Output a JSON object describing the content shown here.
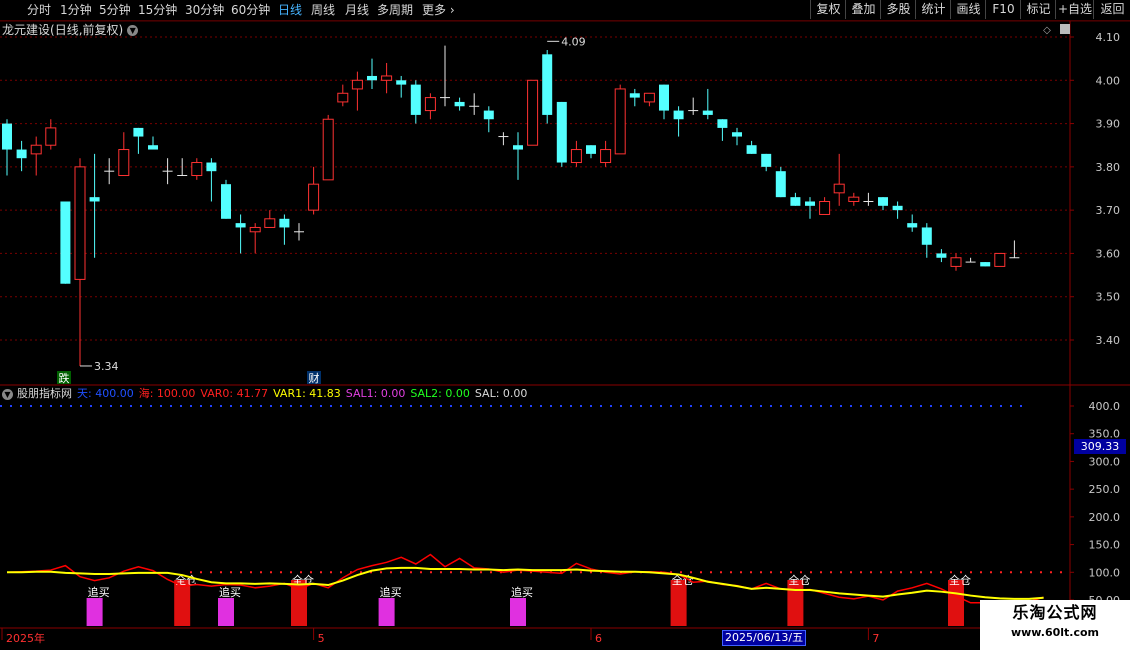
{
  "toolbar": {
    "timeframes": [
      "分时",
      "1分钟",
      "5分钟",
      "15分钟",
      "30分钟",
      "60分钟",
      "日线",
      "周线",
      "月线",
      "多周期",
      "更多"
    ],
    "active": "日线",
    "right_buttons": [
      "复权",
      "叠加",
      "多股",
      "统计",
      "画线",
      "F10",
      "标记",
      "+自选",
      "返回"
    ]
  },
  "stock": {
    "name": "龙元建设",
    "mode": "(日线,前复权)"
  },
  "price_axis": {
    "ticks": [
      "4.10",
      "4.00",
      "3.90",
      "3.80",
      "3.70",
      "3.60",
      "3.50",
      "3.40"
    ],
    "min": 3.34,
    "max": 4.09,
    "ylim": [
      3.34,
      4.12
    ]
  },
  "annotations": {
    "high_label": "4.09",
    "low_label": "3.34",
    "die_tag": "跌",
    "cai_tag": "财"
  },
  "colors": {
    "up": "#ff3232",
    "down": "#54ffff",
    "ma_yellow": "#ffff00",
    "ind_red": "#ff0000",
    "grid": "#7a0000"
  },
  "candles": [
    [
      3.9,
      3.84,
      3.91,
      3.78
    ],
    [
      3.84,
      3.82,
      3.86,
      3.79
    ],
    [
      3.83,
      3.85,
      3.87,
      3.78
    ],
    [
      3.85,
      3.89,
      3.91,
      3.84
    ],
    [
      3.72,
      3.53,
      3.72,
      3.53
    ],
    [
      3.54,
      3.8,
      3.82,
      3.34
    ],
    [
      3.73,
      3.72,
      3.83,
      3.59
    ],
    [
      3.79,
      3.79,
      3.82,
      3.76
    ],
    [
      3.78,
      3.84,
      3.88,
      3.78
    ],
    [
      3.89,
      3.87,
      3.89,
      3.83
    ],
    [
      3.85,
      3.84,
      3.87,
      3.84
    ],
    [
      3.79,
      3.79,
      3.82,
      3.76
    ],
    [
      3.78,
      3.78,
      3.82,
      3.78
    ],
    [
      3.78,
      3.81,
      3.82,
      3.77
    ],
    [
      3.81,
      3.79,
      3.82,
      3.72
    ],
    [
      3.76,
      3.68,
      3.77,
      3.68
    ],
    [
      3.67,
      3.66,
      3.69,
      3.6
    ],
    [
      3.65,
      3.66,
      3.67,
      3.6
    ],
    [
      3.66,
      3.68,
      3.7,
      3.66
    ],
    [
      3.68,
      3.66,
      3.69,
      3.62
    ],
    [
      3.65,
      3.65,
      3.67,
      3.63
    ],
    [
      3.7,
      3.76,
      3.8,
      3.69
    ],
    [
      3.77,
      3.91,
      3.92,
      3.77
    ],
    [
      3.95,
      3.97,
      3.99,
      3.94
    ],
    [
      3.98,
      4.0,
      4.02,
      3.93
    ],
    [
      4.01,
      4.0,
      4.05,
      3.98
    ],
    [
      4.0,
      4.01,
      4.04,
      3.97
    ],
    [
      4.0,
      3.99,
      4.01,
      3.96
    ],
    [
      3.99,
      3.92,
      4.0,
      3.9
    ],
    [
      3.93,
      3.96,
      3.97,
      3.91
    ],
    [
      3.96,
      3.96,
      4.08,
      3.94
    ],
    [
      3.95,
      3.94,
      3.96,
      3.93
    ],
    [
      3.94,
      3.94,
      3.97,
      3.92
    ],
    [
      3.93,
      3.91,
      3.94,
      3.88
    ],
    [
      3.87,
      3.87,
      3.88,
      3.85
    ],
    [
      3.85,
      3.84,
      3.88,
      3.77
    ],
    [
      3.85,
      4.0,
      4.0,
      3.85
    ],
    [
      4.06,
      3.92,
      4.07,
      3.9
    ],
    [
      3.95,
      3.81,
      3.95,
      3.8
    ],
    [
      3.81,
      3.84,
      3.86,
      3.8
    ],
    [
      3.85,
      3.83,
      3.85,
      3.82
    ],
    [
      3.81,
      3.84,
      3.86,
      3.8
    ],
    [
      3.83,
      3.98,
      3.99,
      3.83
    ],
    [
      3.97,
      3.96,
      3.98,
      3.94
    ],
    [
      3.95,
      3.97,
      3.97,
      3.94
    ],
    [
      3.99,
      3.93,
      3.99,
      3.91
    ],
    [
      3.93,
      3.91,
      3.94,
      3.87
    ],
    [
      3.93,
      3.93,
      3.96,
      3.92
    ],
    [
      3.93,
      3.92,
      3.98,
      3.91
    ],
    [
      3.91,
      3.89,
      3.91,
      3.86
    ],
    [
      3.88,
      3.87,
      3.89,
      3.85
    ],
    [
      3.85,
      3.83,
      3.86,
      3.83
    ],
    [
      3.83,
      3.8,
      3.83,
      3.79
    ],
    [
      3.79,
      3.73,
      3.8,
      3.73
    ],
    [
      3.73,
      3.71,
      3.74,
      3.71
    ],
    [
      3.72,
      3.71,
      3.73,
      3.68
    ],
    [
      3.69,
      3.72,
      3.73,
      3.69
    ],
    [
      3.74,
      3.76,
      3.83,
      3.71
    ],
    [
      3.72,
      3.73,
      3.74,
      3.71
    ],
    [
      3.72,
      3.72,
      3.74,
      3.71
    ],
    [
      3.73,
      3.71,
      3.73,
      3.7
    ],
    [
      3.71,
      3.7,
      3.72,
      3.68
    ],
    [
      3.67,
      3.66,
      3.69,
      3.65
    ],
    [
      3.66,
      3.62,
      3.67,
      3.59
    ],
    [
      3.6,
      3.59,
      3.61,
      3.58
    ],
    [
      3.57,
      3.59,
      3.6,
      3.56
    ],
    [
      3.58,
      3.58,
      3.59,
      3.58
    ],
    [
      3.58,
      3.57,
      3.58,
      3.57
    ],
    [
      3.57,
      3.6,
      3.6,
      3.57
    ],
    [
      3.59,
      3.59,
      3.63,
      3.59
    ]
  ],
  "indicator": {
    "name": "股朋指标网",
    "params": [
      {
        "label": "天",
        "value": "400.00",
        "color": "#2050ff"
      },
      {
        "label": "海",
        "value": "100.00",
        "color": "#ff2020"
      },
      {
        "label": "VAR0",
        "value": "41.77",
        "color": "#ff2020"
      },
      {
        "label": "VAR1",
        "value": "41.83",
        "color": "#ffff00"
      },
      {
        "label": "SAL1",
        "value": "0.00",
        "color": "#e040e0"
      },
      {
        "label": "SAL2",
        "value": "0.00",
        "color": "#20ff20"
      },
      {
        "label": "SAL",
        "value": "0.00",
        "color": "#d8d8d8"
      }
    ],
    "axis_ticks": [
      "400.0",
      "350.0",
      "300.0",
      "250.0",
      "200.0",
      "150.0",
      "100.0",
      "50.00"
    ],
    "current_value": "309.33",
    "ylim": [
      40,
      420
    ],
    "red_line": [
      100,
      101,
      102,
      104,
      112,
      92,
      85,
      90,
      102,
      110,
      103,
      87,
      75,
      78,
      75,
      78,
      77,
      72,
      75,
      80,
      70,
      80,
      72,
      90,
      105,
      112,
      118,
      127,
      115,
      132,
      110,
      125,
      108,
      106,
      100,
      104,
      102,
      100,
      98,
      116,
      106,
      100,
      97,
      101,
      101,
      100,
      96,
      82,
      84,
      78,
      76,
      70,
      80,
      70,
      68,
      69,
      62,
      55,
      52,
      57,
      50,
      66,
      72,
      80,
      70,
      57,
      45,
      45,
      45,
      45,
      47,
      55
    ],
    "yellow_line": [
      100,
      100,
      101,
      101,
      99,
      98,
      97,
      97,
      98,
      99,
      99,
      99,
      95,
      88,
      82,
      80,
      80,
      79,
      80,
      79,
      78,
      79,
      77,
      85,
      95,
      103,
      107,
      108,
      108,
      106,
      106,
      106,
      105,
      105,
      104,
      105,
      104,
      104,
      104,
      105,
      103,
      102,
      101,
      101,
      100,
      98,
      96,
      90,
      83,
      79,
      75,
      70,
      72,
      70,
      68,
      68,
      65,
      62,
      60,
      58,
      56,
      60,
      63,
      67,
      65,
      62,
      58,
      55,
      53,
      52,
      52,
      54
    ],
    "signals_buy": [
      {
        "idx": 6,
        "label": "追买"
      },
      {
        "idx": 15,
        "label": "追买"
      },
      {
        "idx": 26,
        "label": "追买"
      },
      {
        "idx": 35,
        "label": "追买"
      }
    ],
    "signals_full": [
      {
        "idx": 12,
        "label": "全仓"
      },
      {
        "idx": 20,
        "label": "全仓"
      },
      {
        "idx": 46,
        "label": "全仓"
      },
      {
        "idx": 54,
        "label": "全仓"
      },
      {
        "idx": 65,
        "label": "全仓"
      }
    ]
  },
  "date_axis": {
    "labels": [
      {
        "text": "2025年",
        "idx": 0
      },
      {
        "text": "5",
        "idx": 21
      },
      {
        "text": "6",
        "idx": 40
      },
      {
        "text": "7",
        "idx": 59
      }
    ],
    "cursor_date": "2025/06/13/五"
  },
  "watermark": {
    "line1": "乐淘公式网",
    "line2": "www.60lt.com"
  }
}
